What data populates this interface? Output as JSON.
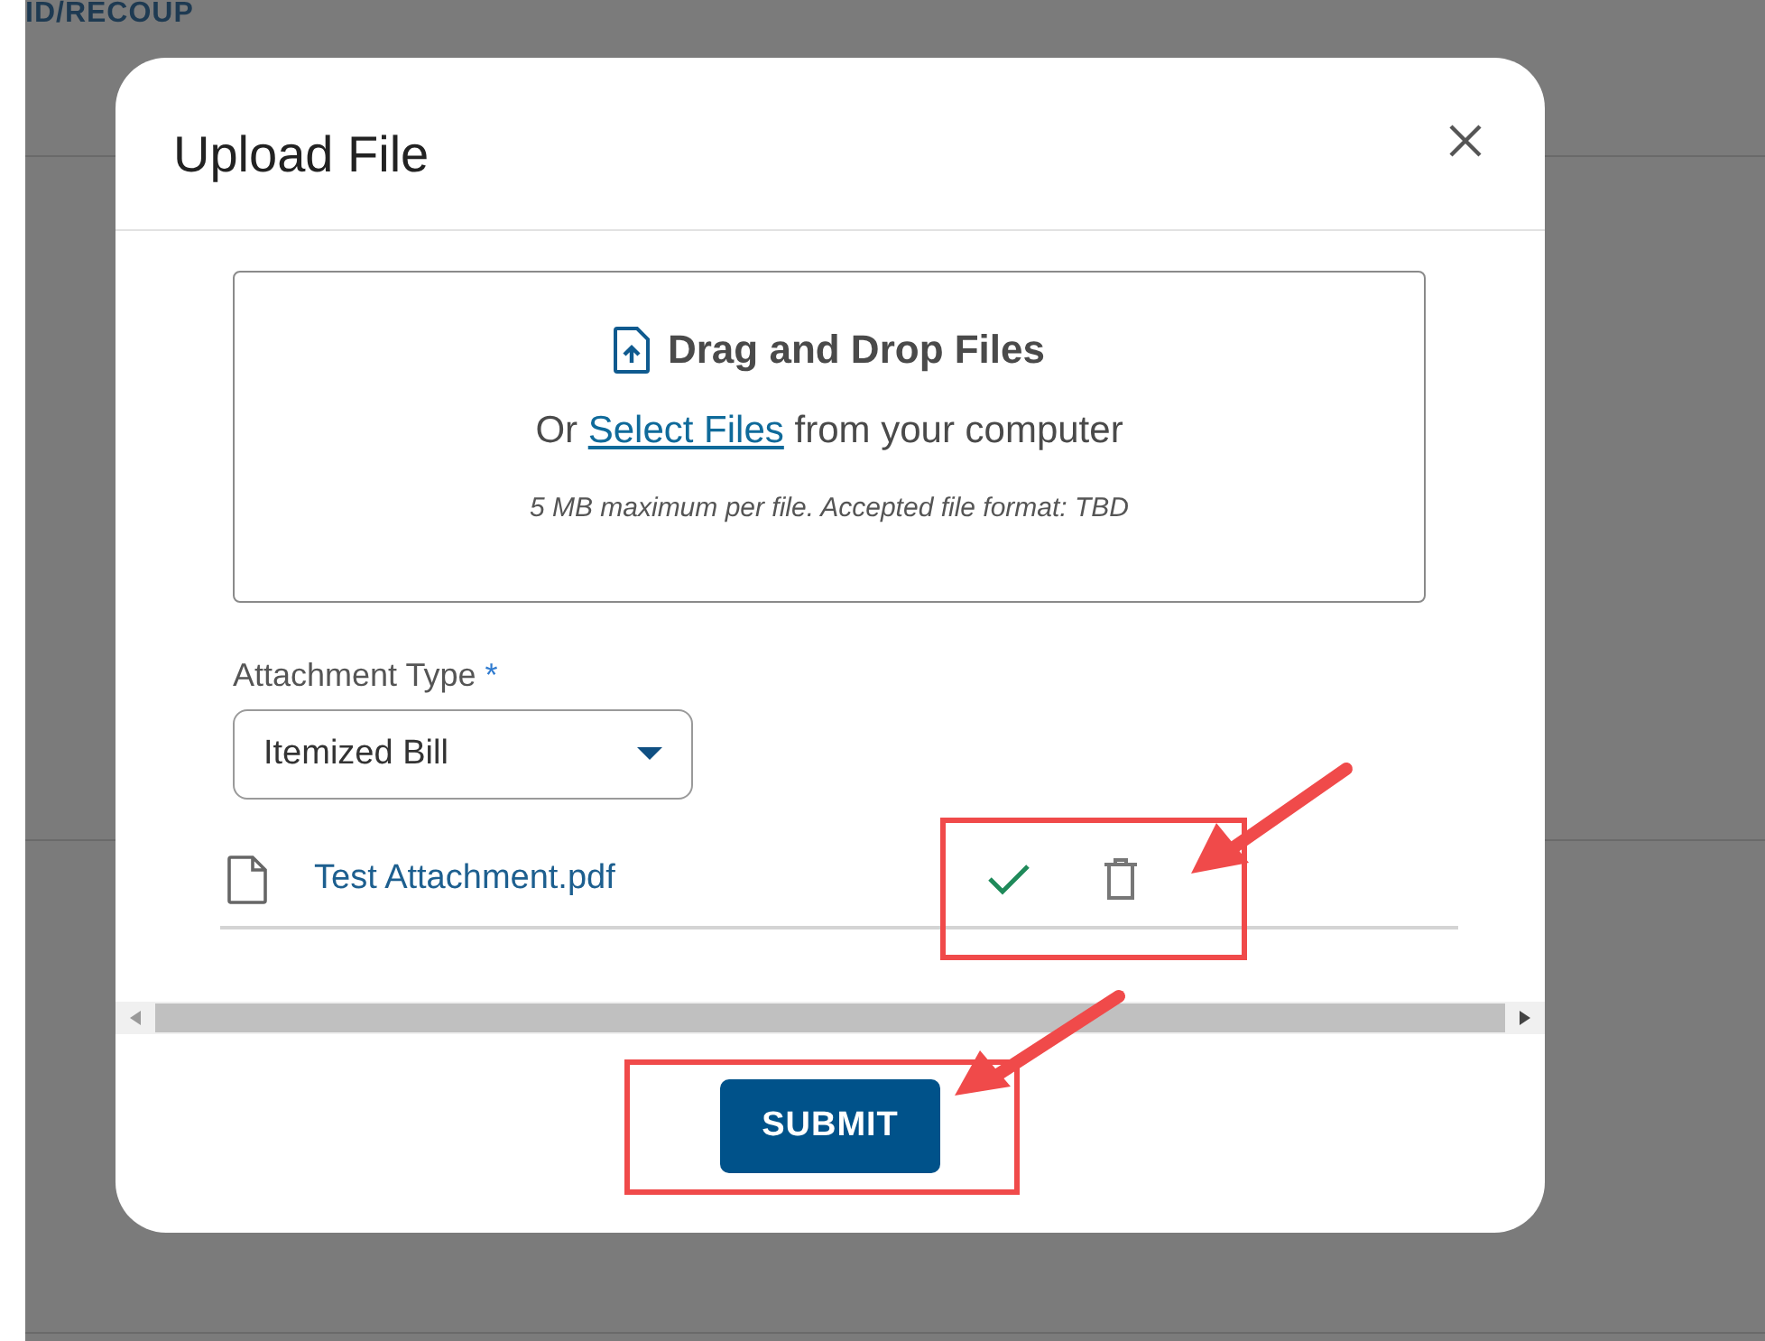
{
  "background": {
    "heading": "ID/RECOUP"
  },
  "dialog": {
    "title": "Upload File",
    "dropzone": {
      "title": "Drag and Drop Files",
      "prefix": "Or",
      "link": "Select Files",
      "suffix": "from your computer",
      "note": "5 MB maximum per file. Accepted file format: TBD"
    },
    "attachment_type": {
      "label": "Attachment Type",
      "required_mark": "*",
      "value": "Itemized Bill"
    },
    "files": [
      {
        "name": "Test Attachment.pdf",
        "uploaded": true
      }
    ],
    "submit": "SUBMIT"
  }
}
